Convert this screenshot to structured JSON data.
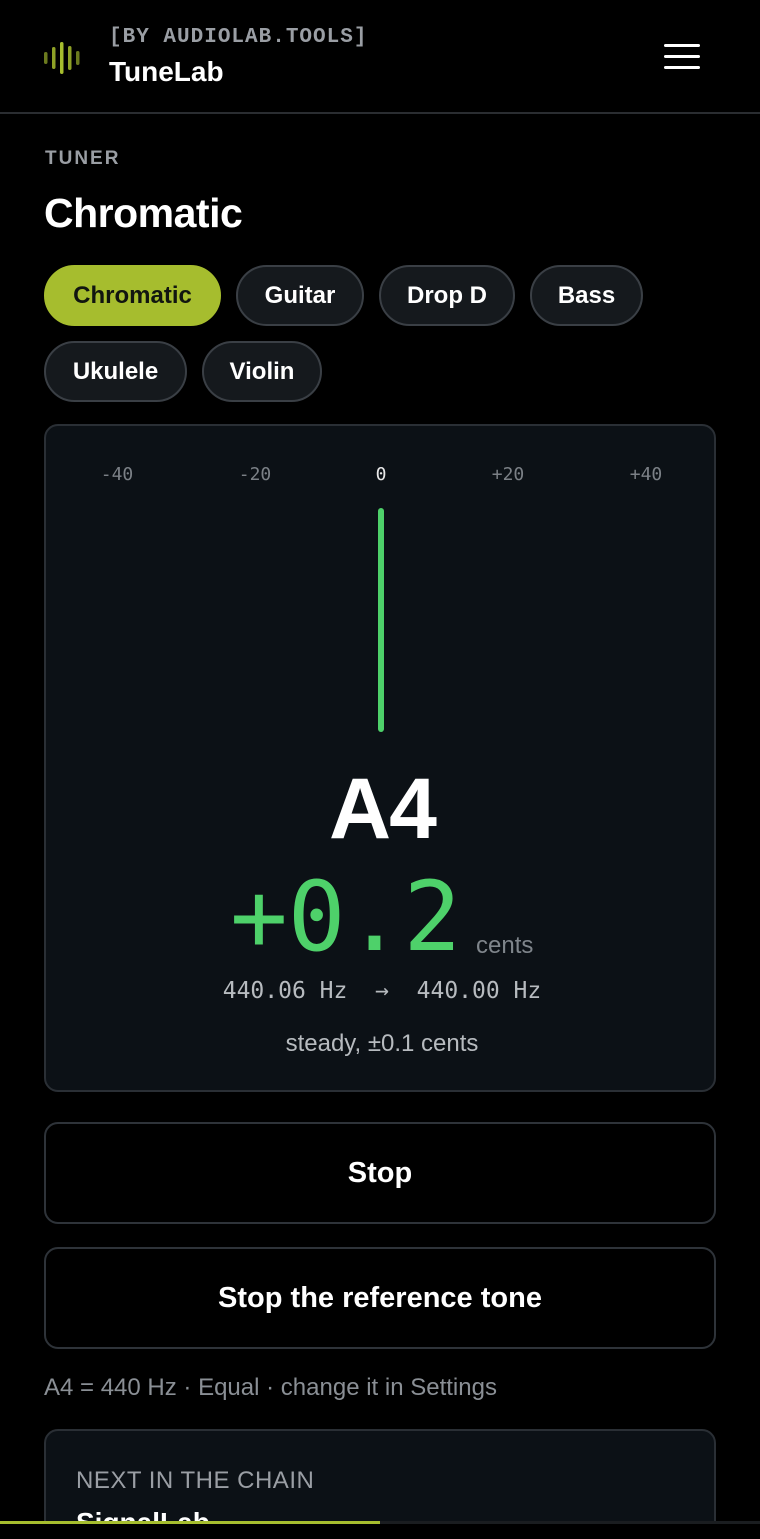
{
  "header": {
    "byline": "[BY AUDIOLAB.TOOLS]",
    "brand": "TuneLab",
    "logo_icon": "waveform-bars-icon",
    "menu_icon": "hamburger-menu-icon"
  },
  "section_label": "TUNER",
  "page_title": "Chromatic",
  "modes": [
    {
      "label": "Chromatic",
      "active": true
    },
    {
      "label": "Guitar",
      "active": false
    },
    {
      "label": "Drop D",
      "active": false
    },
    {
      "label": "Bass",
      "active": false
    },
    {
      "label": "Ukulele",
      "active": false
    },
    {
      "label": "Violin",
      "active": false
    }
  ],
  "tuner": {
    "scale": [
      "-40",
      "-20",
      "0",
      "+20",
      "+40"
    ],
    "note": "A4",
    "cents_value": "+0.2",
    "cents_unit": "cents",
    "detected_hz": "440.06 Hz",
    "arrow": "→",
    "target_hz": "440.00 Hz",
    "stability": "steady, ±0.1 cents"
  },
  "buttons": {
    "stop": "Stop",
    "stop_reference": "Stop the reference tone"
  },
  "reference_info": {
    "prefix": "A4 = 440 Hz · Equal · ",
    "link": "change it in Settings"
  },
  "next": {
    "label": "NEXT IN THE CHAIN",
    "title": "SignalLab"
  },
  "progress": 0.5,
  "colors": {
    "accent": "#a6bd2e",
    "in_tune": "#4ed16a",
    "background": "#000000",
    "card": "#0c1116"
  }
}
